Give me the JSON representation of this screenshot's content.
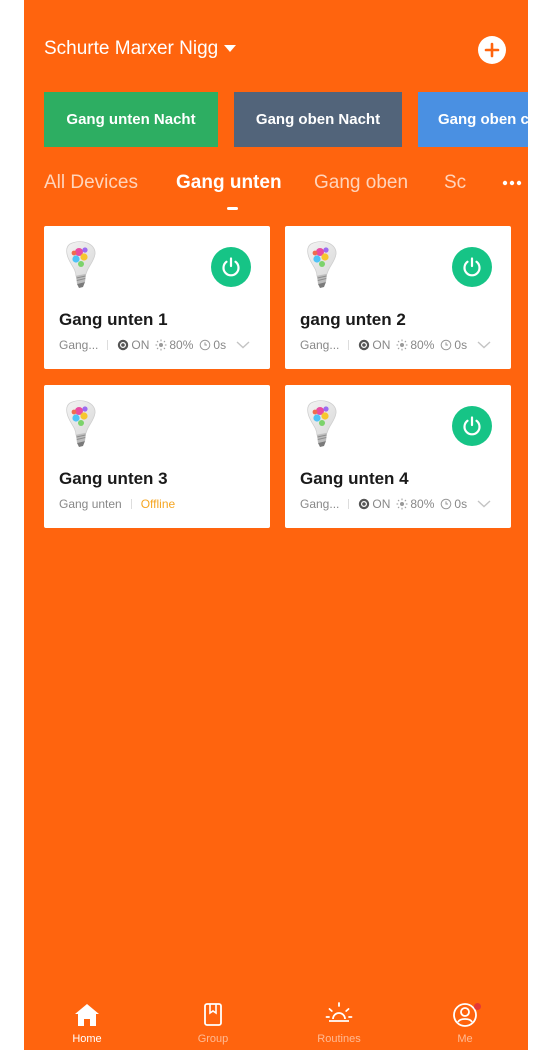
{
  "header": {
    "home_name": "Schurte Marxer Nigg"
  },
  "scenes": [
    {
      "label": "Gang unten Nacht",
      "color": "#2DAE62"
    },
    {
      "label": "Gang oben Nacht",
      "color": "#52647A"
    },
    {
      "label": "Gang oben c",
      "color": "#4A90E2"
    }
  ],
  "tabs": [
    {
      "label": "All Devices",
      "active": false
    },
    {
      "label": "Gang unten",
      "active": true
    },
    {
      "label": "Gang oben",
      "active": false
    },
    {
      "label": "Sc",
      "active": false
    }
  ],
  "devices": [
    {
      "name": "Gang unten 1",
      "room": "Gang...",
      "power": "ON",
      "brightness": "80%",
      "timer": "0s",
      "online": true
    },
    {
      "name": "gang unten 2",
      "room": "Gang...",
      "power": "ON",
      "brightness": "80%",
      "timer": "0s",
      "online": true
    },
    {
      "name": "Gang unten 3",
      "room": "Gang unten",
      "status": "Offline",
      "online": false
    },
    {
      "name": "Gang unten 4",
      "room": "Gang...",
      "power": "ON",
      "brightness": "80%",
      "timer": "0s",
      "online": true
    }
  ],
  "bottom_nav": [
    {
      "label": "Home",
      "icon": "home-icon",
      "active": true
    },
    {
      "label": "Group",
      "icon": "group-icon",
      "active": false
    },
    {
      "label": "Routines",
      "icon": "routines-icon",
      "active": false
    },
    {
      "label": "Me",
      "icon": "me-icon",
      "active": false,
      "badge": true
    }
  ],
  "colors": {
    "background": "#FF640E",
    "power_on": "#16C486",
    "offline": "#F5A623"
  }
}
